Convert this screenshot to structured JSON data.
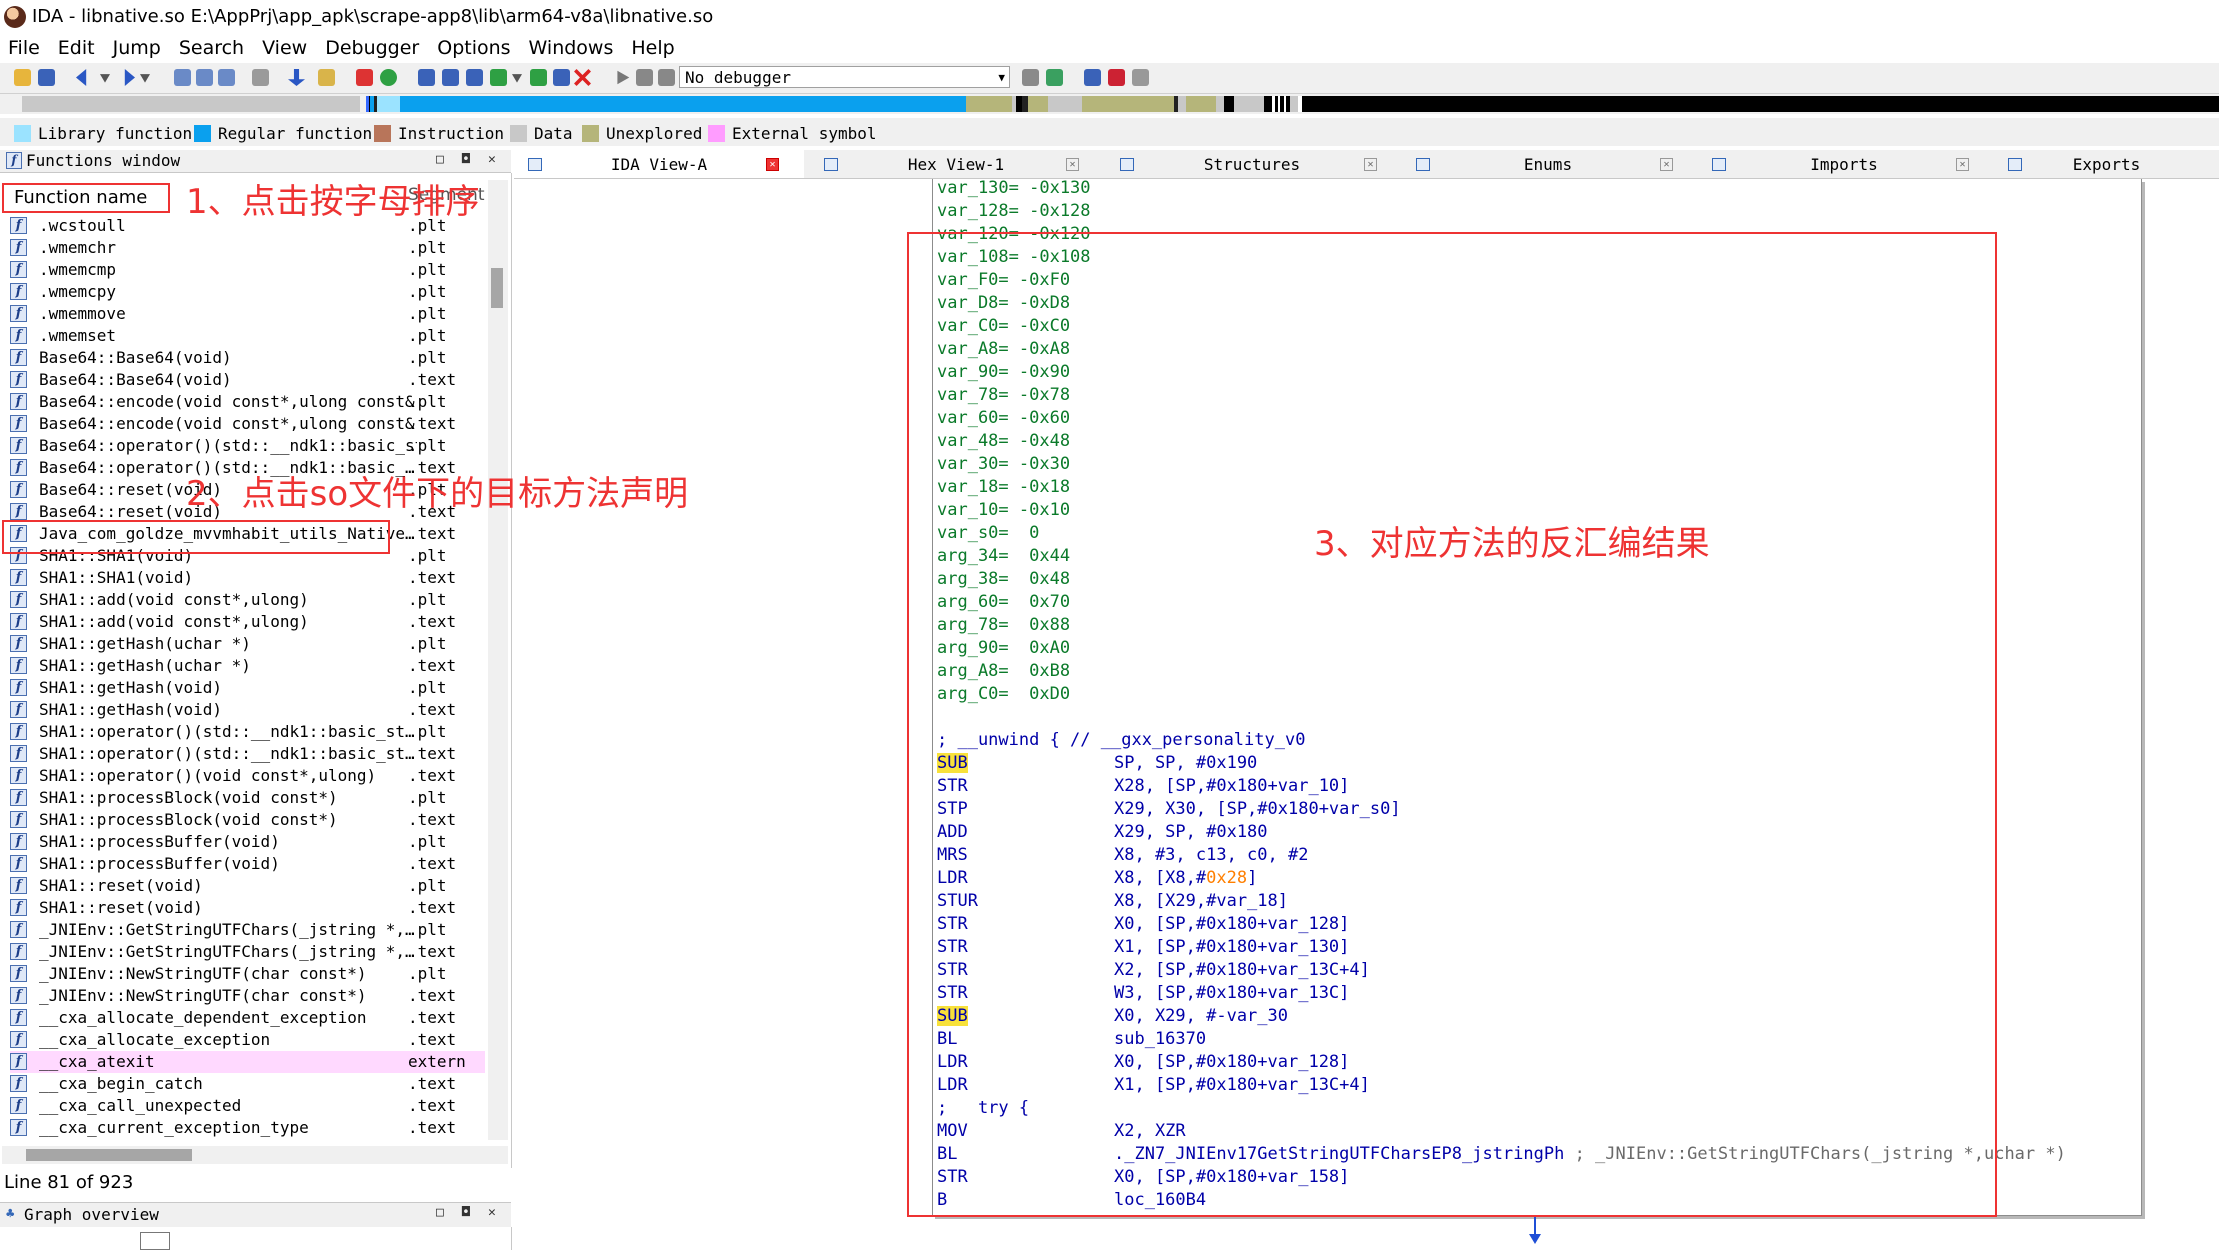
{
  "window": {
    "title": "IDA - libnative.so E:\\AppPrj\\app_apk\\scrape-app8\\lib\\arm64-v8a\\libnative.so"
  },
  "menu": [
    "File",
    "Edit",
    "Jump",
    "Search",
    "View",
    "Debugger",
    "Options",
    "Windows",
    "Help"
  ],
  "toolbar": {
    "debugger_select": "No debugger"
  },
  "legend": [
    {
      "label": "Library function",
      "color": "#9be3ff"
    },
    {
      "label": "Regular function",
      "color": "#0aa0ee"
    },
    {
      "label": "Instruction",
      "color": "#b8755a"
    },
    {
      "label": "Data",
      "color": "#c8c8c8"
    },
    {
      "label": "Unexplored",
      "color": "#b5b57a"
    },
    {
      "label": "External symbol",
      "color": "#ff9cff"
    }
  ],
  "functions_window": {
    "title": "Functions window",
    "column_name": "Function name",
    "column_segment": "Segment",
    "rows": [
      {
        "name": ".wcstoull",
        "seg": ".plt"
      },
      {
        "name": ".wmemchr",
        "seg": ".plt"
      },
      {
        "name": ".wmemcmp",
        "seg": ".plt"
      },
      {
        "name": ".wmemcpy",
        "seg": ".plt"
      },
      {
        "name": ".wmemmove",
        "seg": ".plt"
      },
      {
        "name": ".wmemset",
        "seg": ".plt"
      },
      {
        "name": "Base64::Base64(void)",
        "seg": ".plt"
      },
      {
        "name": "Base64::Base64(void)",
        "seg": ".text"
      },
      {
        "name": "Base64::encode(void const*,ulong const&)",
        "seg": ".plt"
      },
      {
        "name": "Base64::encode(void const*,ulong const&)",
        "seg": ".text"
      },
      {
        "name": "Base64::operator()(std::__ndk1::basic_st…",
        "seg": ".plt"
      },
      {
        "name": "Base64::operator()(std::__ndk1::basic_…",
        "seg": ".text"
      },
      {
        "name": "Base64::reset(void)",
        "seg": ".plt"
      },
      {
        "name": "Base64::reset(void)",
        "seg": ".text"
      },
      {
        "name": "Java_com_goldze_mvvmhabit_utils_Native…",
        "seg": ".text"
      },
      {
        "name": "SHA1::SHA1(void)",
        "seg": ".plt"
      },
      {
        "name": "SHA1::SHA1(void)",
        "seg": ".text"
      },
      {
        "name": "SHA1::add(void const*,ulong)",
        "seg": ".plt"
      },
      {
        "name": "SHA1::add(void const*,ulong)",
        "seg": ".text"
      },
      {
        "name": "SHA1::getHash(uchar *)",
        "seg": ".plt"
      },
      {
        "name": "SHA1::getHash(uchar *)",
        "seg": ".text"
      },
      {
        "name": "SHA1::getHash(void)",
        "seg": ".plt"
      },
      {
        "name": "SHA1::getHash(void)",
        "seg": ".text"
      },
      {
        "name": "SHA1::operator()(std::__ndk1::basic_st…",
        "seg": ".plt"
      },
      {
        "name": "SHA1::operator()(std::__ndk1::basic_st…",
        "seg": ".text"
      },
      {
        "name": "SHA1::operator()(void const*,ulong)",
        "seg": ".text"
      },
      {
        "name": "SHA1::processBlock(void const*)",
        "seg": ".plt"
      },
      {
        "name": "SHA1::processBlock(void const*)",
        "seg": ".text"
      },
      {
        "name": "SHA1::processBuffer(void)",
        "seg": ".plt"
      },
      {
        "name": "SHA1::processBuffer(void)",
        "seg": ".text"
      },
      {
        "name": "SHA1::reset(void)",
        "seg": ".plt"
      },
      {
        "name": "SHA1::reset(void)",
        "seg": ".text"
      },
      {
        "name": "_JNIEnv::GetStringUTFChars(_jstring *,…",
        "seg": ".plt"
      },
      {
        "name": "_JNIEnv::GetStringUTFChars(_jstring *,…",
        "seg": ".text"
      },
      {
        "name": "_JNIEnv::NewStringUTF(char const*)",
        "seg": ".plt"
      },
      {
        "name": "_JNIEnv::NewStringUTF(char const*)",
        "seg": ".text"
      },
      {
        "name": "__cxa_allocate_dependent_exception",
        "seg": ".text"
      },
      {
        "name": "__cxa_allocate_exception",
        "seg": ".text"
      },
      {
        "name": "__cxa_atexit",
        "seg": "extern"
      },
      {
        "name": "__cxa_begin_catch",
        "seg": ".text"
      },
      {
        "name": "__cxa_call_unexpected",
        "seg": ".text"
      },
      {
        "name": "__cxa_current_exception_type",
        "seg": ".text"
      }
    ],
    "line_info": "Line 81 of 923"
  },
  "graph_overview": {
    "title": "Graph overview"
  },
  "tabs": [
    {
      "label": "IDA View-A",
      "active": true
    },
    {
      "label": "Hex View-1",
      "active": false
    },
    {
      "label": "Structures",
      "active": false
    },
    {
      "label": "Enums",
      "active": false
    },
    {
      "label": "Imports",
      "active": false
    },
    {
      "label": "Exports",
      "active": false
    }
  ],
  "disasm": {
    "vars": [
      "var_130= -0x130",
      "var_128= -0x128",
      "var_120= -0x120",
      "var_108= -0x108",
      "var_F0= -0xF0",
      "var_D8= -0xD8",
      "var_C0= -0xC0",
      "var_A8= -0xA8",
      "var_90= -0x90",
      "var_78= -0x78",
      "var_60= -0x60",
      "var_48= -0x48",
      "var_30= -0x30",
      "var_18= -0x18",
      "var_10= -0x10",
      "var_s0=  0",
      "arg_34=  0x44",
      "arg_38=  0x48",
      "arg_60=  0x70",
      "arg_78=  0x88",
      "arg_90=  0xA0",
      "arg_A8=  0xB8",
      "arg_C0=  0xD0"
    ],
    "unwind_comment": "; __unwind { // __gxx_personality_v0",
    "instructions": [
      {
        "mn": "SUB",
        "op": "SP, SP, #0x190",
        "hl": true
      },
      {
        "mn": "STR",
        "op": "X28, [SP,#0x180+var_10]"
      },
      {
        "mn": "STP",
        "op": "X29, X30, [SP,#0x180+var_s0]"
      },
      {
        "mn": "ADD",
        "op": "X29, SP, #0x180"
      },
      {
        "mn": "MRS",
        "op": "X8, #3, c13, c0, #2"
      },
      {
        "mn": "LDR",
        "op": "X8, [X8,#",
        "op_orange": "0x28",
        "op_tail": "]"
      },
      {
        "mn": "STUR",
        "op": "X8, [X29,#var_18]"
      },
      {
        "mn": "STR",
        "op": "X0, [SP,#0x180+var_128]"
      },
      {
        "mn": "STR",
        "op": "X1, [SP,#0x180+var_130]"
      },
      {
        "mn": "STR",
        "op": "X2, [SP,#0x180+var_13C+4]"
      },
      {
        "mn": "STR",
        "op": "W3, [SP,#0x180+var_13C]"
      },
      {
        "mn": "SUB",
        "op": "X0, X29, #-var_30",
        "hl": true
      },
      {
        "mn": "BL",
        "op": "sub_16370"
      },
      {
        "mn": "LDR",
        "op": "X0, [SP,#0x180+var_128]"
      },
      {
        "mn": "LDR",
        "op": "X1, [SP,#0x180+var_13C+4]"
      }
    ],
    "try_comment": ";   try {",
    "instructions2": [
      {
        "mn": "MOV",
        "op": "X2, XZR"
      },
      {
        "mn": "BL",
        "op": "._ZN7_JNIEnv17GetStringUTFCharsEP8_jstringPh",
        "comment": " ; _JNIEnv::GetStringUTFChars(_jstring *,uchar *)"
      },
      {
        "mn": "STR",
        "op": "X0, [SP,#0x180+var_158]"
      },
      {
        "mn": "B",
        "op": "loc_160B4"
      }
    ]
  },
  "annotations": {
    "step1": "1、点击按字母排序",
    "step2": "2、点击so文件下的目标方法声明",
    "step3": "3、对应方法的反汇编结果"
  }
}
